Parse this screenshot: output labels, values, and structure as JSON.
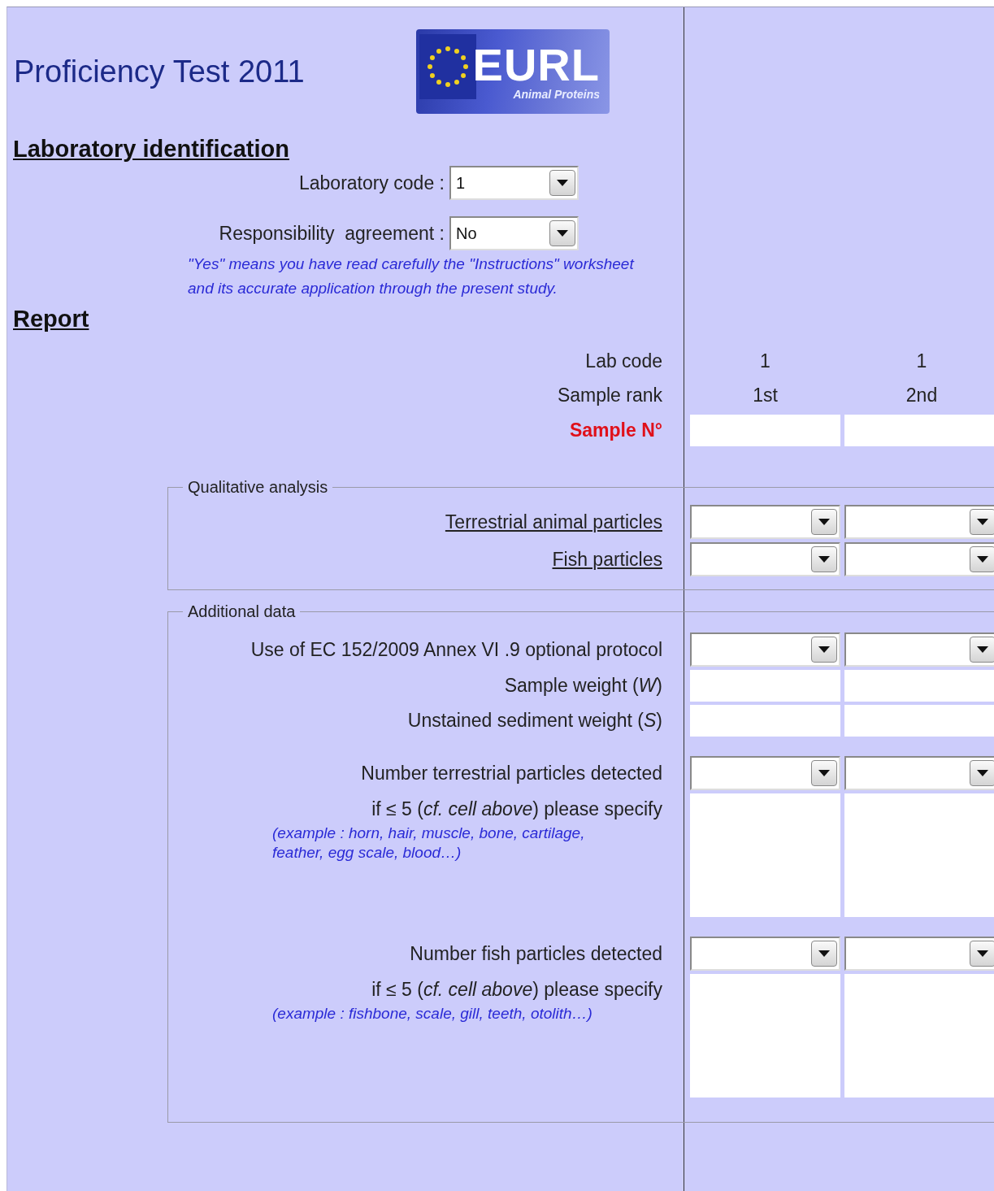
{
  "header": {
    "title": "Proficiency Test 2011",
    "logo": {
      "word": "EURL",
      "tagline": "Animal Proteins"
    }
  },
  "lab_identification": {
    "heading": "Laboratory identification",
    "fields": [
      {
        "label": "Laboratory code :",
        "value": "1"
      },
      {
        "label": "Responsibility  agreement :",
        "value": "No"
      }
    ],
    "note": "\"Yes\" means you have read carefully the \"Instructions\" worksheet and its accurate application through the present study."
  },
  "report": {
    "heading": "Report",
    "header_rows": [
      {
        "label": "Lab code",
        "kind": "text",
        "cells": [
          "1",
          "1"
        ]
      },
      {
        "label": "Sample rank",
        "kind": "text",
        "cells": [
          "1st",
          "2nd"
        ]
      },
      {
        "label": "Sample N°",
        "kind": "input"
      }
    ],
    "groups": [
      {
        "legend": "Qualitative analysis",
        "rows": [
          {
            "label": "Terrestrial animal particles",
            "kind": "dropdown",
            "link": true
          },
          {
            "label": "Fish particles",
            "kind": "dropdown",
            "link": true
          }
        ]
      },
      {
        "legend": "Additional data",
        "rows": [
          {
            "label": "Use of EC 152/2009 Annex VI .9 optional protocol",
            "kind": "dropdown",
            "link": false
          },
          {
            "label": "Sample weight (*W*)",
            "kind": "input",
            "link": false
          },
          {
            "label": "Unstained sediment weight (*S*)",
            "kind": "input",
            "link": false
          },
          {
            "label": "Number terrestrial particles detected",
            "kind": "dropdown",
            "link": false
          },
          {
            "label": "if ≤ 5 (*cf. cell above*) please specify",
            "kind": "textarea",
            "link": false,
            "note": "(example : horn, hair, muscle, bone, cartilage, feather, egg scale, blood…)"
          },
          {
            "label": "Number fish particles detected",
            "kind": "dropdown",
            "link": false
          },
          {
            "label": "if ≤ 5 (*cf. cell above*) please specify",
            "kind": "textarea",
            "link": false,
            "note": "(example : fishbone, scale, gill, teeth, otolith…)"
          }
        ]
      }
    ]
  }
}
